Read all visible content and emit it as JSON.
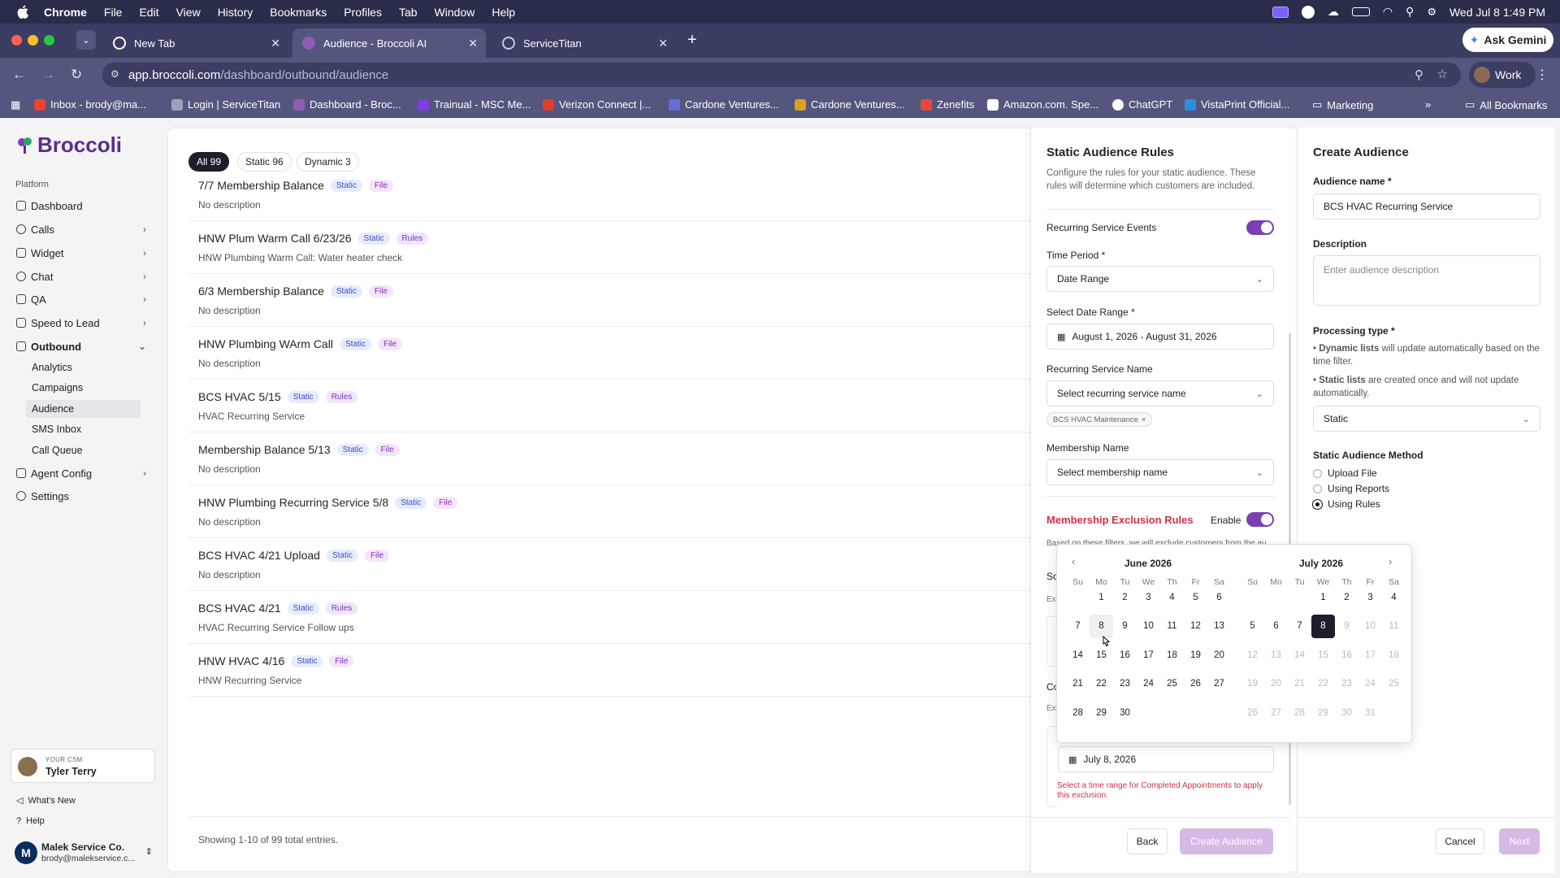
{
  "menubar": {
    "app": "Chrome",
    "items": [
      "File",
      "Edit",
      "View",
      "History",
      "Bookmarks",
      "Profiles",
      "Tab",
      "Window",
      "Help"
    ],
    "clock": "Wed Jul 8  1:49 PM"
  },
  "tabs": [
    {
      "title": "New Tab"
    },
    {
      "title": "Audience - Broccoli AI"
    },
    {
      "title": "ServiceTitan"
    }
  ],
  "gemini": "Ask Gemini",
  "omnibox": {
    "host": "app.broccoli.com",
    "path": "/dashboard/outbound/audience"
  },
  "profile": "Work",
  "bookmarks": [
    "Inbox - brody@ma...",
    "Login | ServiceTitan",
    "Dashboard - Broc...",
    "Trainual - MSC Me...",
    "Verizon Connect |...",
    "Cardone Ventures...",
    "Cardone Ventures...",
    "Zenefits",
    "Amazon.com. Spe...",
    "ChatGPT",
    "VistaPrint Official...",
    "Marketing",
    "All Bookmarks"
  ],
  "sidebar": {
    "logo": "Broccoli",
    "section": "Platform",
    "nav": [
      "Dashboard",
      "Calls",
      "Widget",
      "Chat",
      "QA",
      "Speed to Lead",
      "Outbound"
    ],
    "outbound_sub": [
      "Analytics",
      "Campaigns",
      "Audience",
      "SMS Inbox",
      "Call Queue"
    ],
    "nav2": [
      "Agent Config",
      "Settings"
    ],
    "csm_label": "YOUR CSM",
    "csm_name": "Tyler Terry",
    "whats_new": "What's New",
    "help": "Help",
    "company": "Malek Service Co.",
    "email": "brody@malekservice.c..."
  },
  "filters": [
    "All 99",
    "Static 96",
    "Dynamic 3"
  ],
  "rows": [
    {
      "title": "7/7 Membership Balance",
      "b1": "Static",
      "b2": "File",
      "desc": "No description"
    },
    {
      "title": "HNW Plum Warm Call 6/23/26",
      "b1": "Static",
      "b2": "Rules",
      "desc": "HNW Plumbing Warm Call: Water heater check"
    },
    {
      "title": "6/3 Membership Balance",
      "b1": "Static",
      "b2": "File",
      "desc": "No description"
    },
    {
      "title": "HNW Plumbing WArm Call",
      "b1": "Static",
      "b2": "File",
      "desc": "No description"
    },
    {
      "title": "BCS HVAC 5/15",
      "b1": "Static",
      "b2": "Rules",
      "desc": "HVAC Recurring Service"
    },
    {
      "title": "Membership Balance 5/13",
      "b1": "Static",
      "b2": "File",
      "desc": "No description"
    },
    {
      "title": "HNW Plumbing Recurring Service 5/8",
      "b1": "Static",
      "b2": "File",
      "desc": "No description"
    },
    {
      "title": "BCS HVAC 4/21 Upload",
      "b1": "Static",
      "b2": "File",
      "desc": "No description"
    },
    {
      "title": "BCS HVAC 4/21",
      "b1": "Static",
      "b2": "Rules",
      "desc": "HVAC Recurring Service Follow ups"
    },
    {
      "title": "HNW HVAC 4/16",
      "b1": "Static",
      "b2": "File",
      "desc": "HNW Recurring Service"
    }
  ],
  "showing": "Showing 1-10 of 99 total entries.",
  "rules": {
    "title": "Static Audience Rules",
    "subtitle": "Configure the rules for your static audience. These rules will determine which customers are included.",
    "recurring_events": "Recurring Service Events",
    "time_period_label": "Time Period *",
    "time_period": "Date Range",
    "date_range_label": "Select Date Range *",
    "date_range": "August 1, 2026 - August 31, 2026",
    "service_name_label": "Recurring Service Name",
    "service_name_ph": "Select recurring service name",
    "chip": "BCS HVAC Maintenance",
    "membership_label": "Membership Name",
    "membership_ph": "Select membership name",
    "excl_title": "Membership Exclusion Rules",
    "enable": "Enable",
    "excl_desc": "Based on these filters, we will exclude customers from the au",
    "peek_sc": "Sc",
    "peek_exc": "Exc",
    "peek_co": "Co",
    "peek_exc2": "Exc",
    "date_single": "July 8, 2026",
    "error": "Select a time range for Completed Appointments to apply this exclusion.",
    "back": "Back",
    "create": "Create Audience"
  },
  "create": {
    "title": "Create Audience",
    "name_label": "Audience name *",
    "name": "BCS HVAC Recurring Service",
    "desc_label": "Description",
    "desc_ph": "Enter audience description",
    "proc_label": "Processing type *",
    "dyn_bold": "Dynamic lists",
    "dyn_rest": " will update automatically based on the time filter.",
    "stat_bold": "Static lists",
    "stat_rest": " are created once and will not update automatically.",
    "proc": "Static",
    "method_label": "Static Audience Method",
    "methods": [
      "Upload File",
      "Using Reports",
      "Using Rules"
    ],
    "cancel": "Cancel",
    "next": "Next"
  },
  "calendar": {
    "dows": [
      "Su",
      "Mo",
      "Tu",
      "We",
      "Th",
      "Fr",
      "Sa"
    ],
    "left": {
      "title": "June 2026",
      "offset": 1,
      "days": 30
    },
    "right": {
      "title": "July 2026",
      "offset": 3,
      "days": 31
    },
    "selected": "July 8",
    "hover": "June 8"
  }
}
